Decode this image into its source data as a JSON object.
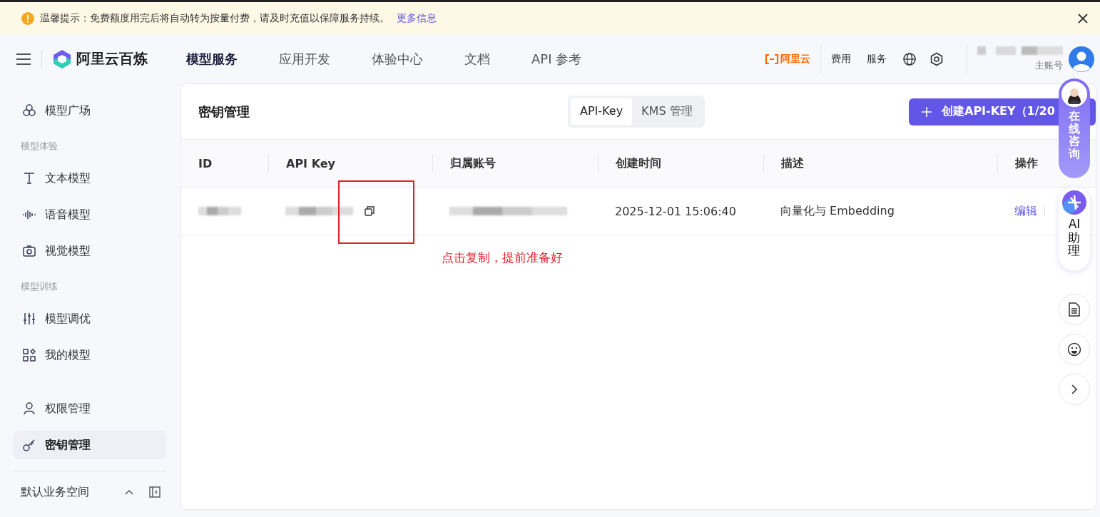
{
  "banner": {
    "text": "温馨提示：免费额度用完后将自动转为按量付费，请及时充值以保障服务持续。",
    "link": "更多信息"
  },
  "header": {
    "logo": "阿里云百炼",
    "nav": [
      {
        "label": "模型服务",
        "selected": true
      },
      {
        "label": "应用开发",
        "selected": false
      },
      {
        "label": "体验中心",
        "selected": false
      },
      {
        "label": "文档",
        "selected": false
      },
      {
        "label": "API 参考",
        "selected": false
      }
    ],
    "brand": "阿里云",
    "links": [
      "费用",
      "服务"
    ],
    "account_role": "主账号"
  },
  "sidebar": {
    "items": [
      {
        "kind": "item",
        "label": "模型广场",
        "selected": false
      },
      {
        "kind": "section",
        "label": "模型体验"
      },
      {
        "kind": "item",
        "label": "文本模型",
        "selected": false
      },
      {
        "kind": "item",
        "label": "语音模型",
        "selected": false
      },
      {
        "kind": "item",
        "label": "视觉模型",
        "selected": false
      },
      {
        "kind": "section",
        "label": "模型训练"
      },
      {
        "kind": "item",
        "label": "模型调优",
        "selected": false
      },
      {
        "kind": "item",
        "label": "我的模型",
        "selected": false
      },
      {
        "kind": "item",
        "label": "权限管理",
        "selected": false
      },
      {
        "kind": "item",
        "label": "密钥管理",
        "selected": true
      }
    ],
    "workspace": "默认业务空间"
  },
  "page": {
    "title": "密钥管理",
    "tabs": [
      {
        "label": "API-Key",
        "selected": true
      },
      {
        "label": "KMS 管理",
        "selected": false
      }
    ],
    "create_button": "创建API-KEY（1/20"
  },
  "table": {
    "columns": [
      "ID",
      "API Key",
      "归属账号",
      "创建时间",
      "描述",
      "操作"
    ],
    "rows": [
      {
        "created": "2025-12-01 15:06:40",
        "description": "向量化与 Embedding",
        "actions": [
          "编辑"
        ]
      }
    ]
  },
  "annotation": "点击复制，提前准备好",
  "float": {
    "consult": "在线咨询",
    "assistant": "AI助理"
  }
}
